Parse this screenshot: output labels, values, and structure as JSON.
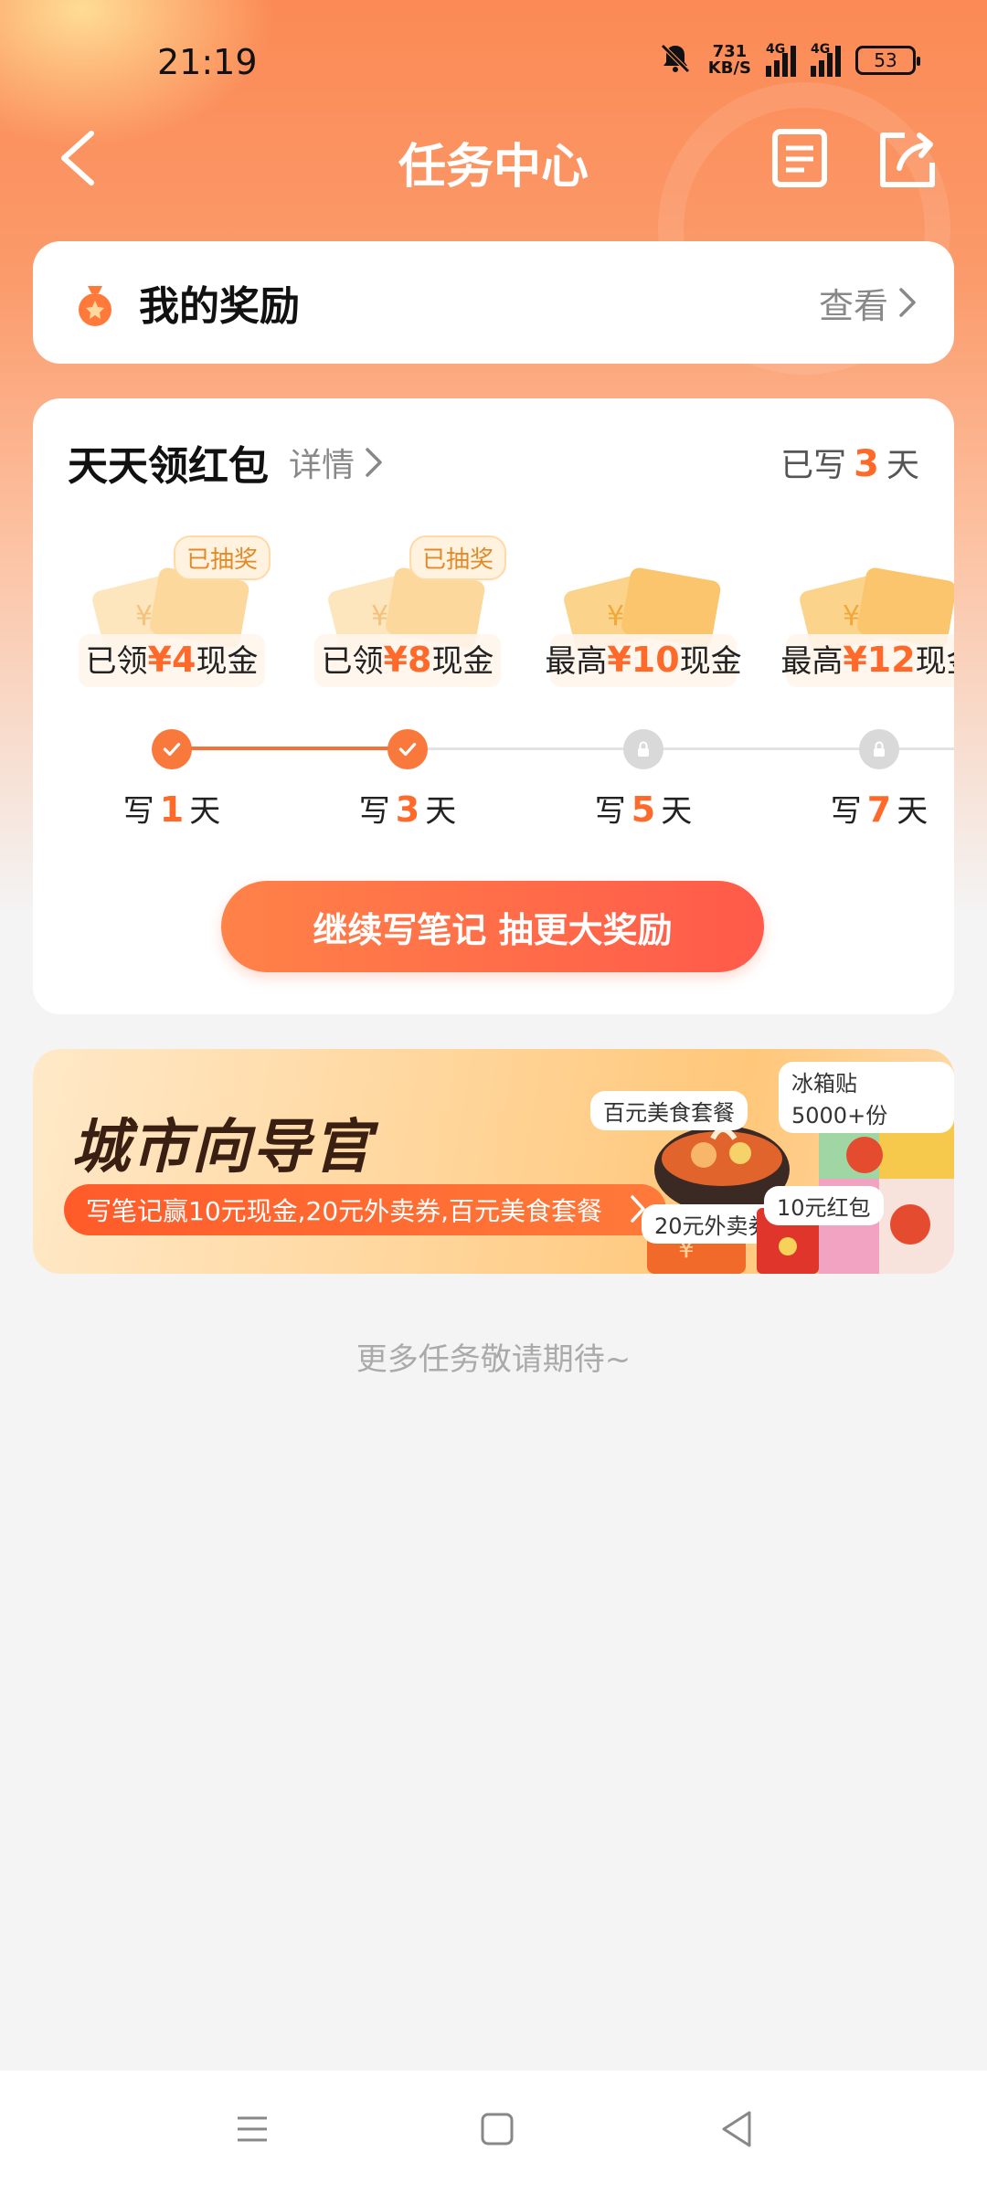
{
  "status_bar": {
    "time": "21:19",
    "net_speed_value": "731",
    "net_speed_unit": "KB/S",
    "signal1_tag": "4G",
    "signal2_tag": "4G",
    "battery": "53"
  },
  "header": {
    "title": "任务中心"
  },
  "rewards": {
    "title": "我的奖励",
    "view_label": "查看"
  },
  "daily": {
    "title": "天天领红包",
    "detail_label": "详情",
    "written_prefix": "已写",
    "written_days": "3",
    "written_suffix": "天",
    "milestones": [
      {
        "prefix": "已领",
        "amount": "¥4",
        "suffix": "现金",
        "badge": "已抽奖",
        "status": "done"
      },
      {
        "prefix": "已领",
        "amount": "¥8",
        "suffix": "现金",
        "badge": "已抽奖",
        "status": "done"
      },
      {
        "prefix": "最高",
        "amount": "¥10",
        "suffix": "现金",
        "badge": "",
        "status": "locked"
      },
      {
        "prefix": "最高",
        "amount": "¥12",
        "suffix": "现金",
        "badge": "",
        "status": "locked"
      }
    ],
    "days": [
      {
        "prefix": "写",
        "n": "1",
        "suffix": "天"
      },
      {
        "prefix": "写",
        "n": "3",
        "suffix": "天"
      },
      {
        "prefix": "写",
        "n": "5",
        "suffix": "天"
      },
      {
        "prefix": "写",
        "n": "7",
        "suffix": "天"
      }
    ],
    "cta": "继续写笔记 抽更大奖励"
  },
  "banner": {
    "title": "城市向导官",
    "subtitle": "写笔记赢10元现金,20元外卖券,百元美食套餐",
    "tag_food": "百元美食套餐",
    "tag_fridge": "冰箱贴5000+份",
    "tag_coupon": "20元外卖券",
    "tag_redpack": "10元红包"
  },
  "footer_tip": "更多任务敬请期待~",
  "colors": {
    "accent": "#ff6a2a",
    "header_gradient_top": "#fb8a55"
  }
}
